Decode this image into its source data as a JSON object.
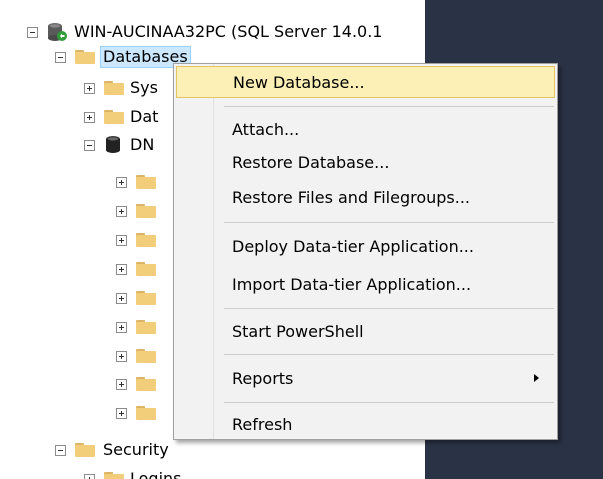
{
  "server": {
    "label": "WIN-AUCINAA32PC (SQL Server 14.0.1"
  },
  "tree": {
    "databases_label": "Databases",
    "system_label": "Sys",
    "snapshots_label": "Dat",
    "dn_label": "DN",
    "security_label": "Security",
    "logins_label": "Logins"
  },
  "context_menu": {
    "new_database": "New Database...",
    "attach": "Attach...",
    "restore_database": "Restore Database...",
    "restore_files": "Restore Files and Filegroups...",
    "deploy_dac": "Deploy Data-tier Application...",
    "import_dac": "Import Data-tier Application...",
    "start_powershell": "Start PowerShell",
    "reports": "Reports",
    "refresh": "Refresh"
  },
  "icons": {
    "server": "server-connected-icon",
    "folder": "folder-icon",
    "database": "database-icon",
    "submenu_arrow": "submenu-arrow-icon"
  }
}
